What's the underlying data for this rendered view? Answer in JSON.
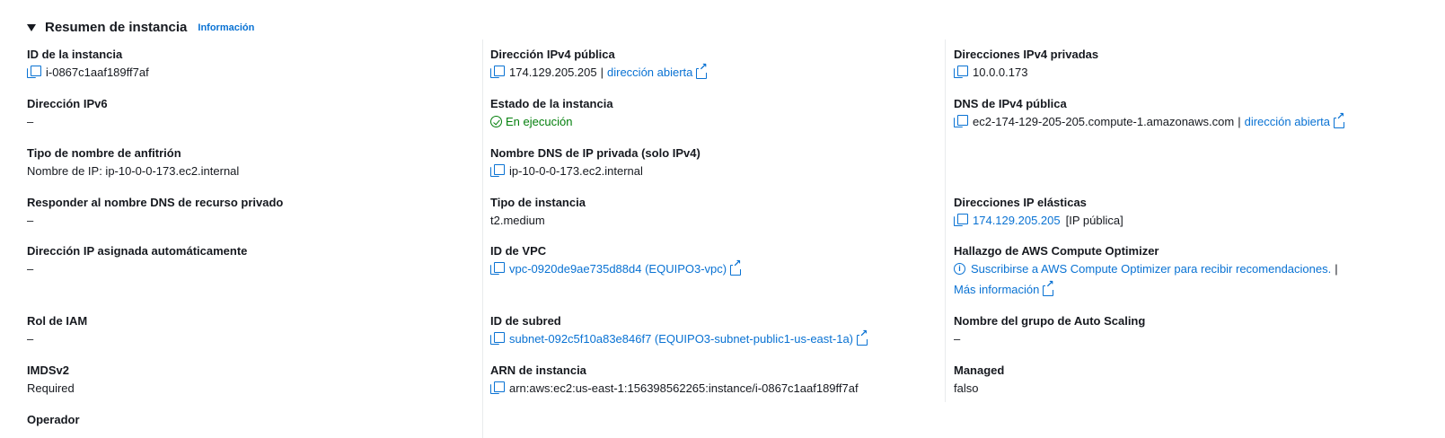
{
  "header": {
    "title": "Resumen de instancia",
    "info_link": "Información"
  },
  "col1": {
    "instance_id": {
      "label": "ID de la instancia",
      "value": "i-0867c1aaf189ff7af"
    },
    "ipv6": {
      "label": "Dirección IPv6",
      "value": "–"
    },
    "hostname_type": {
      "label": "Tipo de nombre de anfitrión",
      "value": "Nombre de IP: ip-10-0-0-173.ec2.internal"
    },
    "respond_dns": {
      "label": "Responder al nombre DNS de recurso privado",
      "value": "–"
    },
    "auto_ip": {
      "label": "Dirección IP asignada automáticamente",
      "value": "–"
    },
    "iam_role": {
      "label": "Rol de IAM",
      "value": "–"
    },
    "imdsv2": {
      "label": "IMDSv2",
      "value": "Required"
    },
    "operator": {
      "label": "Operador"
    }
  },
  "col2": {
    "public_ipv4": {
      "label": "Dirección IPv4 pública",
      "value": "174.129.205.205",
      "link": "dirección abierta"
    },
    "state": {
      "label": "Estado de la instancia",
      "value": "En ejecución"
    },
    "private_dns": {
      "label": "Nombre DNS de IP privada (solo IPv4)",
      "value": "ip-10-0-0-173.ec2.internal"
    },
    "instance_type": {
      "label": "Tipo de instancia",
      "value": "t2.medium"
    },
    "vpc": {
      "label": "ID de VPC",
      "value": "vpc-0920de9ae735d88d4 (EQUIPO3-vpc)"
    },
    "subnet": {
      "label": "ID de subred",
      "value": "subnet-092c5f10a83e846f7 (EQUIPO3-subnet-public1-us-east-1a)"
    },
    "arn": {
      "label": "ARN de instancia",
      "value": "arn:aws:ec2:us-east-1:156398562265:instance/i-0867c1aaf189ff7af"
    }
  },
  "col3": {
    "private_ipv4": {
      "label": "Direcciones IPv4 privadas",
      "value": "10.0.0.173"
    },
    "public_dns": {
      "label": "DNS de IPv4 pública",
      "value": "ec2-174-129-205-205.compute-1.amazonaws.com",
      "link": "dirección abierta"
    },
    "elastic_ip": {
      "label": "Direcciones IP elásticas",
      "value": "174.129.205.205",
      "suffix": "[IP pública]"
    },
    "optimizer": {
      "label": "Hallazgo de AWS Compute Optimizer",
      "link": "Suscribirse a AWS Compute Optimizer para recibir recomendaciones.",
      "more": "Más información"
    },
    "asg": {
      "label": "Nombre del grupo de Auto Scaling",
      "value": "–"
    },
    "managed": {
      "label": "Managed",
      "value": "falso"
    }
  },
  "colors": {
    "link": "#0972d3",
    "success": "#037f0c",
    "text": "#16191f"
  }
}
